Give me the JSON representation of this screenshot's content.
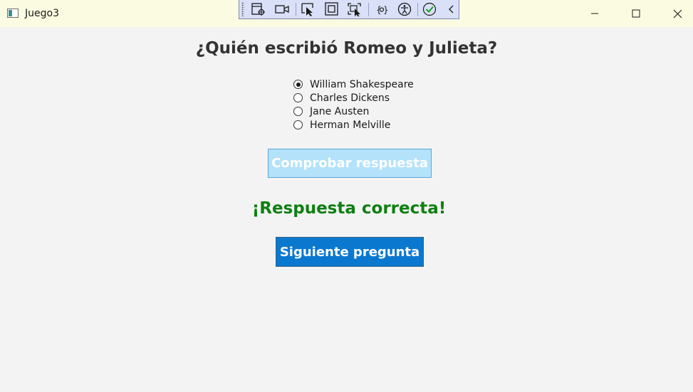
{
  "window": {
    "title": "Juego3",
    "controls": [
      "minimize-icon",
      "maximize-icon",
      "close-icon"
    ]
  },
  "debug_toolbar": {
    "icons": [
      "select-element-icon",
      "video-camera-icon",
      "pointer-select-icon",
      "display-layout-adorners-icon",
      "track-focused-element-icon",
      "binding-failures-icon",
      "accessibility-icon",
      "check-icon",
      "collapse-chevron-icon"
    ]
  },
  "quiz": {
    "question": "¿Quién escribió Romeo y Julieta?",
    "options": [
      {
        "label": "William Shakespeare",
        "selected": true
      },
      {
        "label": "Charles Dickens",
        "selected": false
      },
      {
        "label": "Jane Austen",
        "selected": false
      },
      {
        "label": "Herman Melville",
        "selected": false
      }
    ],
    "check_button": "Comprobar respuesta",
    "result": "¡Respuesta correcta!",
    "next_button": "Siguiente pregunta"
  },
  "colors": {
    "titlebar_bg": "#fbfbe1",
    "result_green": "#0f7f12",
    "next_button_bg": "#0b78d0",
    "check_button_disabled_bg": "#b3e2fa"
  }
}
